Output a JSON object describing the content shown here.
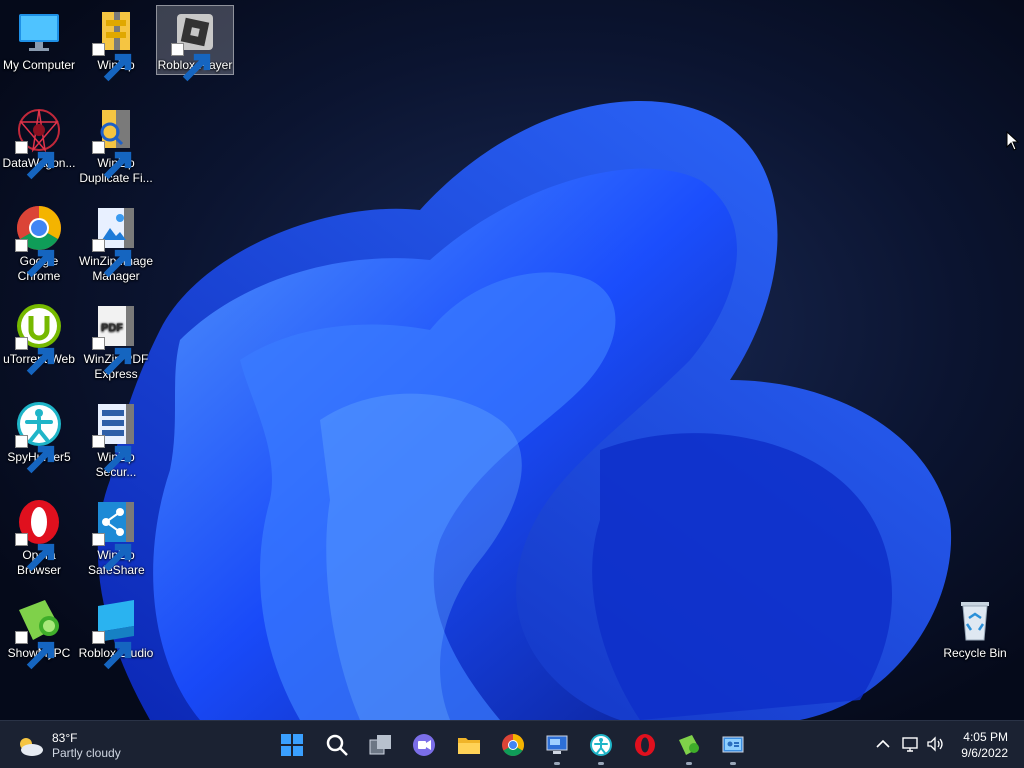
{
  "desktop": {
    "icons": [
      {
        "label": "My Computer"
      },
      {
        "label": "WinZip"
      },
      {
        "label": "Roblox Player"
      },
      {
        "label": "DataWagon..."
      },
      {
        "label": "WinZip Duplicate Fi..."
      },
      {
        "label": "Google Chrome"
      },
      {
        "label": "WinZip Image Manager"
      },
      {
        "label": "uTorrent Web"
      },
      {
        "label": "WinZip PDF Express"
      },
      {
        "label": "SpyHunter5"
      },
      {
        "label": "WinZip Secur..."
      },
      {
        "label": "Opera Browser"
      },
      {
        "label": "WinZip SafeShare"
      },
      {
        "label": "ShowMyPC"
      },
      {
        "label": "Roblox Studio"
      },
      {
        "label": "Recycle Bin"
      }
    ],
    "selected_icon": "Roblox Player"
  },
  "taskbar": {
    "weather": {
      "temperature": "83°F",
      "condition": "Partly cloudy"
    },
    "pinned": [
      "start-icon",
      "search-icon",
      "task-view-icon",
      "teams-chat-icon",
      "file-explorer-icon",
      "chrome-icon",
      "remote-desktop-icon",
      "spyhunter-icon",
      "opera-icon",
      "showmypc-icon",
      "control-panel-icon"
    ],
    "clock": {
      "time": "4:05 PM",
      "date": "9/6/2022"
    }
  },
  "colors": {
    "accent": "#1a4dff",
    "taskbar": "#1b2232",
    "wallpaper_bg": "#050a1a"
  }
}
